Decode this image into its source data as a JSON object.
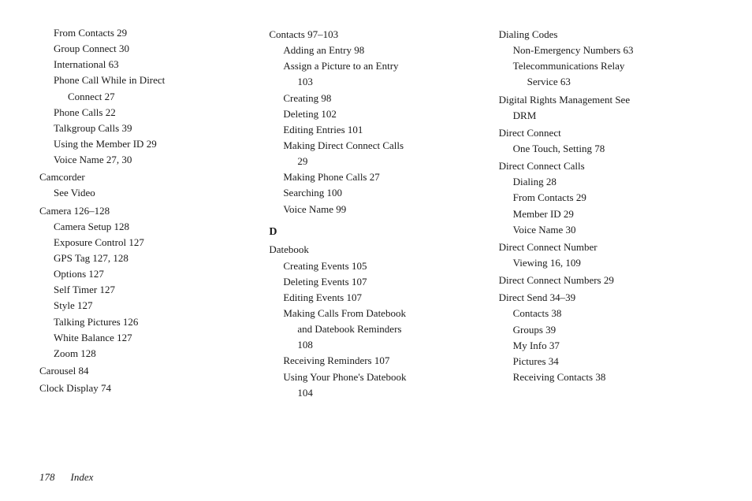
{
  "columns": [
    {
      "id": "col1",
      "entries": [
        {
          "level": 1,
          "text": "From Contacts 29"
        },
        {
          "level": 1,
          "text": "Group Connect 30"
        },
        {
          "level": 1,
          "text": "International 63"
        },
        {
          "level": 1,
          "text": "Phone Call While in Direct"
        },
        {
          "level": 2,
          "text": "Connect 27"
        },
        {
          "level": 1,
          "text": "Phone Calls 22"
        },
        {
          "level": 1,
          "text": "Talkgroup Calls 39"
        },
        {
          "level": 1,
          "text": "Using the Member ID 29"
        },
        {
          "level": 1,
          "text": "Voice Name 27, 30"
        },
        {
          "level": 0,
          "text": "Camcorder"
        },
        {
          "level": 1,
          "text": "See Video"
        },
        {
          "level": 0,
          "text": "Camera 126–128"
        },
        {
          "level": 1,
          "text": "Camera Setup 128"
        },
        {
          "level": 1,
          "text": "Exposure Control 127"
        },
        {
          "level": 1,
          "text": "GPS Tag 127, 128"
        },
        {
          "level": 1,
          "text": "Options 127"
        },
        {
          "level": 1,
          "text": "Self Timer 127"
        },
        {
          "level": 1,
          "text": "Style 127"
        },
        {
          "level": 1,
          "text": "Talking Pictures 126"
        },
        {
          "level": 1,
          "text": "White Balance 127"
        },
        {
          "level": 1,
          "text": "Zoom 128"
        },
        {
          "level": 0,
          "text": "Carousel 84"
        },
        {
          "level": 0,
          "text": "Clock Display 74"
        }
      ]
    },
    {
      "id": "col2",
      "entries": [
        {
          "level": 0,
          "text": "Contacts 97–103"
        },
        {
          "level": 1,
          "text": "Adding an Entry 98"
        },
        {
          "level": 1,
          "text": "Assign a Picture to an Entry"
        },
        {
          "level": 2,
          "text": "103"
        },
        {
          "level": 1,
          "text": "Creating 98"
        },
        {
          "level": 1,
          "text": "Deleting 102"
        },
        {
          "level": 1,
          "text": "Editing Entries 101"
        },
        {
          "level": 1,
          "text": "Making Direct Connect Calls"
        },
        {
          "level": 2,
          "text": "29"
        },
        {
          "level": 1,
          "text": "Making Phone Calls 27"
        },
        {
          "level": 1,
          "text": "Searching 100"
        },
        {
          "level": 1,
          "text": "Voice Name 99"
        },
        {
          "level": "letter",
          "text": "D"
        },
        {
          "level": 0,
          "text": "Datebook"
        },
        {
          "level": 1,
          "text": "Creating Events 105"
        },
        {
          "level": 1,
          "text": "Deleting Events 107"
        },
        {
          "level": 1,
          "text": "Editing Events 107"
        },
        {
          "level": 1,
          "text": "Making Calls From Datebook"
        },
        {
          "level": 2,
          "text": "and Datebook Reminders"
        },
        {
          "level": 2,
          "text": "108"
        },
        {
          "level": 1,
          "text": "Receiving Reminders 107"
        },
        {
          "level": 1,
          "text": "Using Your Phone's Datebook"
        },
        {
          "level": 2,
          "text": "104"
        }
      ]
    },
    {
      "id": "col3",
      "entries": [
        {
          "level": 0,
          "text": "Dialing Codes"
        },
        {
          "level": 1,
          "text": "Non-Emergency Numbers 63"
        },
        {
          "level": 1,
          "text": "Telecommunications Relay"
        },
        {
          "level": 2,
          "text": "Service 63"
        },
        {
          "level": 0,
          "text": "Digital Rights Management See"
        },
        {
          "level": 1,
          "text": "DRM"
        },
        {
          "level": 0,
          "text": "Direct Connect"
        },
        {
          "level": 1,
          "text": "One Touch, Setting 78"
        },
        {
          "level": 0,
          "text": "Direct Connect Calls"
        },
        {
          "level": 1,
          "text": "Dialing 28"
        },
        {
          "level": 1,
          "text": "From Contacts 29"
        },
        {
          "level": 1,
          "text": "Member ID 29"
        },
        {
          "level": 1,
          "text": "Voice Name 30"
        },
        {
          "level": 0,
          "text": "Direct Connect Number"
        },
        {
          "level": 1,
          "text": "Viewing 16, 109"
        },
        {
          "level": 0,
          "text": "Direct Connect Numbers 29"
        },
        {
          "level": 0,
          "text": "Direct Send 34–39"
        },
        {
          "level": 1,
          "text": "Contacts 38"
        },
        {
          "level": 1,
          "text": "Groups 39"
        },
        {
          "level": 1,
          "text": "My Info 37"
        },
        {
          "level": 1,
          "text": "Pictures 34"
        },
        {
          "level": 1,
          "text": "Receiving Contacts 38"
        }
      ]
    }
  ],
  "footer": {
    "page": "178",
    "label": "Index"
  }
}
